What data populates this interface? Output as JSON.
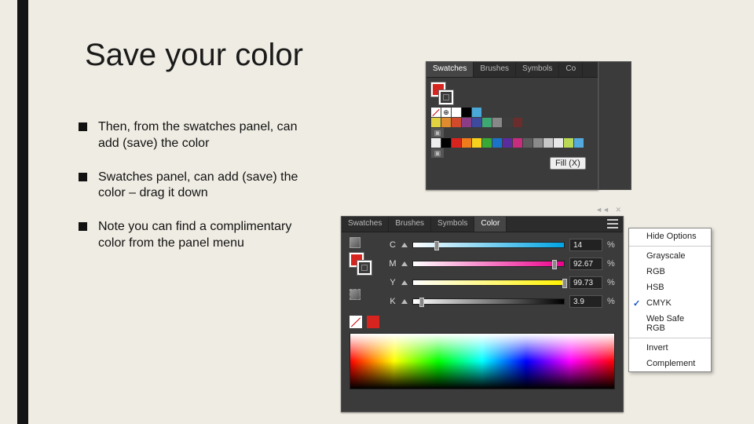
{
  "title": "Save your color",
  "bullets": [
    "Then, from the swatches panel, can add (save) the color",
    "Swatches panel, can add (save) the color – drag it down",
    "Note you can find a complimentary color from the panel menu"
  ],
  "swatches_panel": {
    "tabs": [
      "Swatches",
      "Brushes",
      "Symbols",
      "Co"
    ],
    "active_tab": "Swatches",
    "tooltip": "Fill (X)",
    "rows": [
      [
        "none",
        "reg",
        "#ffffff",
        "#000000",
        "#4aa8d8"
      ],
      [
        "#e3d240",
        "#df8b2e",
        "#d24a2c",
        "#8b3d88",
        "#3d4a9e",
        "#3da872",
        "#888888",
        "#3d3d3d",
        "#6b2c2c"
      ],
      [
        "group"
      ],
      [
        "#eeeeee",
        "#000000",
        "#d8241f",
        "#ee7c1a",
        "#f7d11c",
        "#39a935",
        "#1a73c7",
        "#5a2c9e",
        "#c72c7e",
        "#5c5c5c",
        "#8a8a8a",
        "#c8c8c8",
        "#e8e8e8",
        "#bada55",
        "#55aadd"
      ],
      [
        "group"
      ]
    ]
  },
  "color_panel": {
    "tabs": [
      "Swatches",
      "Brushes",
      "Symbols",
      "Color"
    ],
    "active_tab": "Color",
    "channels": [
      {
        "label": "C",
        "class": "c",
        "value": "14",
        "pos": 14
      },
      {
        "label": "M",
        "class": "m",
        "value": "92.67",
        "pos": 92
      },
      {
        "label": "Y",
        "class": "y",
        "value": "99.73",
        "pos": 99
      },
      {
        "label": "K",
        "class": "k",
        "value": "3.9",
        "pos": 4
      }
    ]
  },
  "flyout": {
    "items": [
      {
        "label": "Hide Options",
        "checked": false,
        "sepAfter": true
      },
      {
        "label": "Grayscale",
        "checked": false
      },
      {
        "label": "RGB",
        "checked": false
      },
      {
        "label": "HSB",
        "checked": false
      },
      {
        "label": "CMYK",
        "checked": true
      },
      {
        "label": "Web Safe RGB",
        "checked": false,
        "sepAfter": true
      },
      {
        "label": "Invert",
        "checked": false
      },
      {
        "label": "Complement",
        "checked": false
      }
    ]
  }
}
